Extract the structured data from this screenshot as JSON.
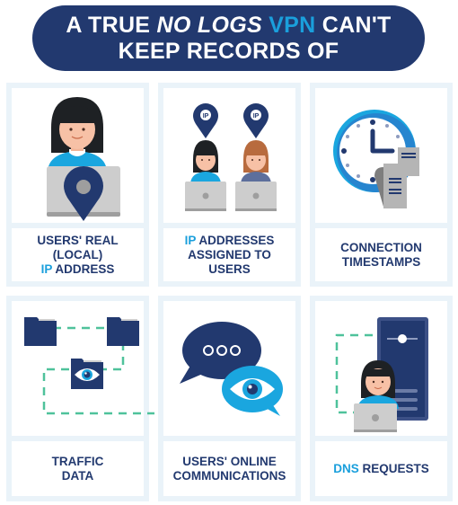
{
  "title": {
    "part1": "A TRUE",
    "part2_italic": "NO LOGS",
    "part3_accent": "VPN",
    "part4": "CAN'T",
    "line2": "KEEP RECORDS OF"
  },
  "colors": {
    "navy": "#22396f",
    "accent_blue": "#1a9fdc",
    "cell_border": "#eaf3f9",
    "dashed_green": "#4fc29b",
    "laptop_gray": "#c9c9c9"
  },
  "items": [
    {
      "caption_lines": [
        "USERS' REAL",
        "(LOCAL)"
      ],
      "caption_hl": "IP",
      "caption_tail": "ADDRESS",
      "icon": "user-laptop-location-pin-icon"
    },
    {
      "caption_hl": "IP",
      "caption_line1_tail": "ADDRESSES",
      "caption_lines": [
        "ASSIGNED TO",
        "USERS"
      ],
      "icon": "users-ip-pins-icon",
      "pin_label": "IP"
    },
    {
      "caption_lines": [
        "CONNECTION",
        "TIMESTAMPS"
      ],
      "icon": "clock-receipt-icon"
    },
    {
      "caption_lines": [
        "TRAFFIC",
        "DATA"
      ],
      "icon": "folders-eye-network-icon"
    },
    {
      "caption_lines": [
        "USERS' ONLINE",
        "COMMUNICATIONS"
      ],
      "icon": "chat-bubbles-eye-icon"
    },
    {
      "caption_hl": "DNS",
      "caption_tail": "REQUESTS",
      "icon": "user-server-icon"
    }
  ]
}
